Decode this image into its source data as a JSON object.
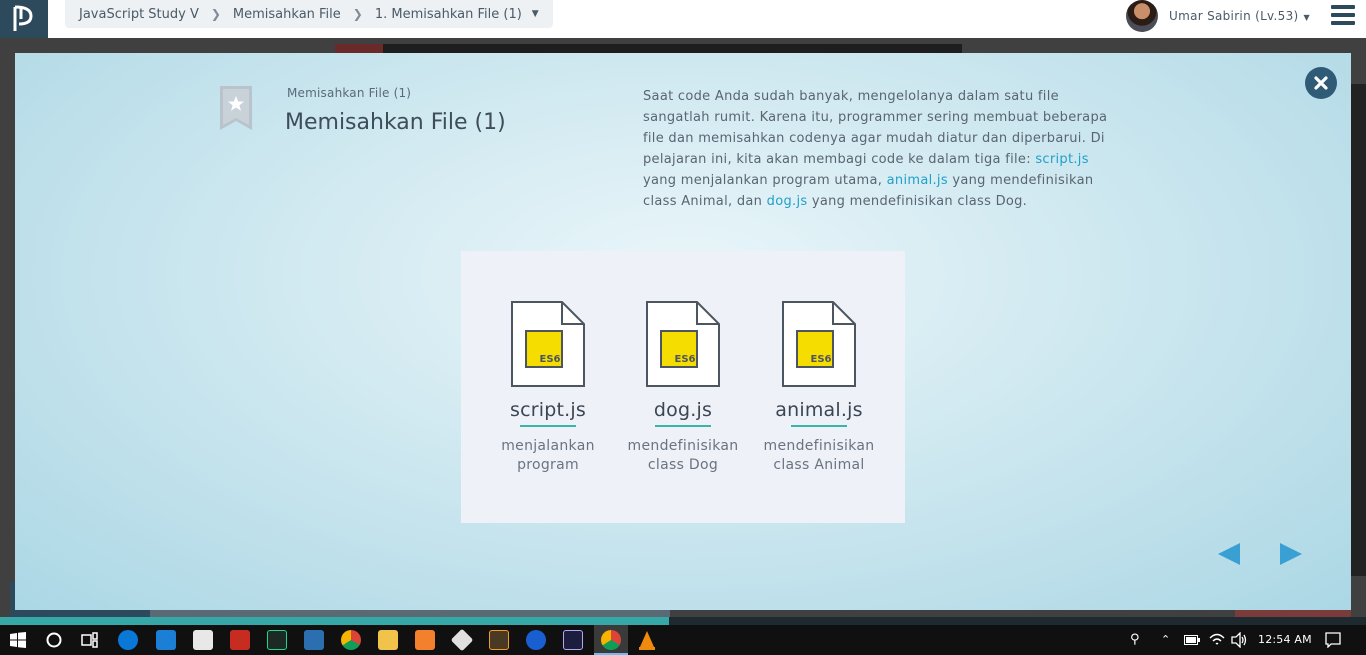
{
  "breadcrumb": {
    "items": [
      "JavaScript Study V",
      "Memisahkan File",
      "1. Memisahkan File (1)"
    ]
  },
  "user": {
    "name": "Umar Sabirin (Lv.53)"
  },
  "lesson": {
    "subtitle": "Memisahkan File (1)",
    "title": "Memisahkan File (1)",
    "description": {
      "p1": "Saat code Anda sudah banyak, mengelolanya dalam satu file sangatlah rumit. Karena itu, programmer sering membuat beberapa file dan memisahkan codenya agar mudah diatur dan diperbarui. Di pelajaran ini, kita akan membagi code ke dalam tiga file: ",
      "link1": "script.js",
      "p2": " yang menjalankan program utama, ",
      "link2": "animal.js",
      "p3": " yang mendefinisikan class Animal, dan ",
      "link3": "dog.js",
      "p4": " yang mendefinisikan class Dog."
    }
  },
  "files": [
    {
      "badge": "ES6",
      "name": "script.js",
      "desc1": "menjalankan",
      "desc2": "program"
    },
    {
      "badge": "ES6",
      "name": "dog.js",
      "desc1": "mendefinisikan",
      "desc2": "class Dog"
    },
    {
      "badge": "ES6",
      "name": "animal.js",
      "desc1": "mendefinisikan",
      "desc2": "class Animal"
    }
  ],
  "progress": {
    "fraction": 0.49
  },
  "taskbar": {
    "clock": "12:54 AM",
    "apps": [
      "start-icon",
      "cortana-icon",
      "task-view-icon",
      "edge-icon",
      "mail-icon",
      "store-icon",
      "filezilla-icon",
      "pycharm-icon",
      "powershell-icon",
      "chrome-icon",
      "file-explorer-icon",
      "xampp-icon",
      "git-icon",
      "sublime-icon",
      "maps-icon",
      "photoshop-icon",
      "chrome-active-icon",
      "vlc-icon"
    ]
  },
  "colors": {
    "accent": "#21a0c9",
    "navy": "#2f5b76",
    "es6_yellow": "#f5dd00",
    "underline_teal": "#38b6a8"
  }
}
